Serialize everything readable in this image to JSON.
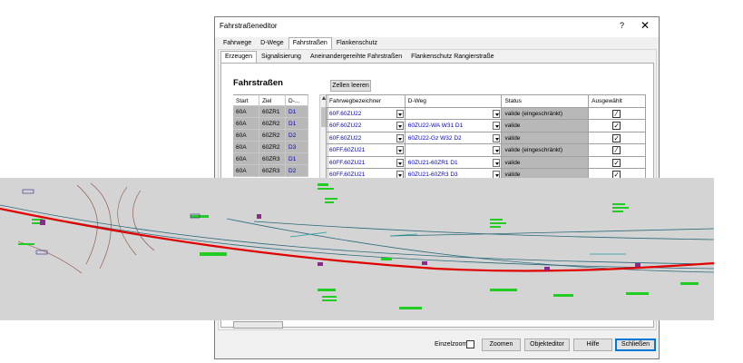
{
  "window": {
    "title": "Fahrstraßeneditor",
    "help": "?",
    "close": "✕"
  },
  "tabs": [
    "Fahrwege",
    "D-Wege",
    "Fahrstraßen",
    "Flankenschutz"
  ],
  "subtabs": [
    "Erzeugen",
    "Signalisierung",
    "Aneinandergereihte Fahrstraßen",
    "Flankenschutz Rangierstraße"
  ],
  "section_title": "Fahrstraßen",
  "clear_cells_button": "Zellen leeren",
  "left_grid": {
    "headers": [
      "Start",
      "Ziel",
      "D-..."
    ],
    "rows": [
      [
        "60A",
        "60ZR1",
        "D1"
      ],
      [
        "60A",
        "60ZR2",
        "D1"
      ],
      [
        "60A",
        "60ZR2",
        "D2"
      ],
      [
        "60A",
        "60ZR2",
        "D3"
      ],
      [
        "60A",
        "60ZR3",
        "D1"
      ],
      [
        "60A",
        "60ZR3",
        "D2"
      ]
    ]
  },
  "right_grid": {
    "headers": [
      "Fahrwegbezeichner",
      "D-Weg",
      "Status",
      "Ausgewählt"
    ],
    "rows": [
      {
        "fahrweg": "60F.60ZU22",
        "dweg": "",
        "status": "valide (eingeschränkt)",
        "checked": "⁄"
      },
      {
        "fahrweg": "60F.60ZU22",
        "dweg": "60ZU22-WA W31 D1",
        "status": "valide",
        "checked": "✓"
      },
      {
        "fahrweg": "60F.60ZU22",
        "dweg": "60ZU22-Gz W32 D2",
        "status": "valide",
        "checked": "✓"
      },
      {
        "fahrweg": "60FF.60ZU21",
        "dweg": "",
        "status": "valide (eingeschränkt)",
        "checked": "⁄"
      },
      {
        "fahrweg": "60FF.60ZU21",
        "dweg": "60ZU21-60ZR1 D1",
        "status": "valide",
        "checked": "✓"
      },
      {
        "fahrweg": "60FF.60ZU21",
        "dweg": "60ZU21-60ZR3 D3",
        "status": "valide",
        "checked": "✓"
      }
    ]
  },
  "footer": {
    "einzelzoom_label": "Einzelzoom",
    "zoom_button": "Zoomen",
    "objekteditor_button": "Objekteditor",
    "hilfe_button": "Hilfe",
    "schliessen_button": "Schließen"
  },
  "colors": {
    "track_main": "#e00000",
    "track_secondary": "#2a7a5a",
    "labels_green": "#22cc22",
    "map_background": "#d4d4d4"
  }
}
